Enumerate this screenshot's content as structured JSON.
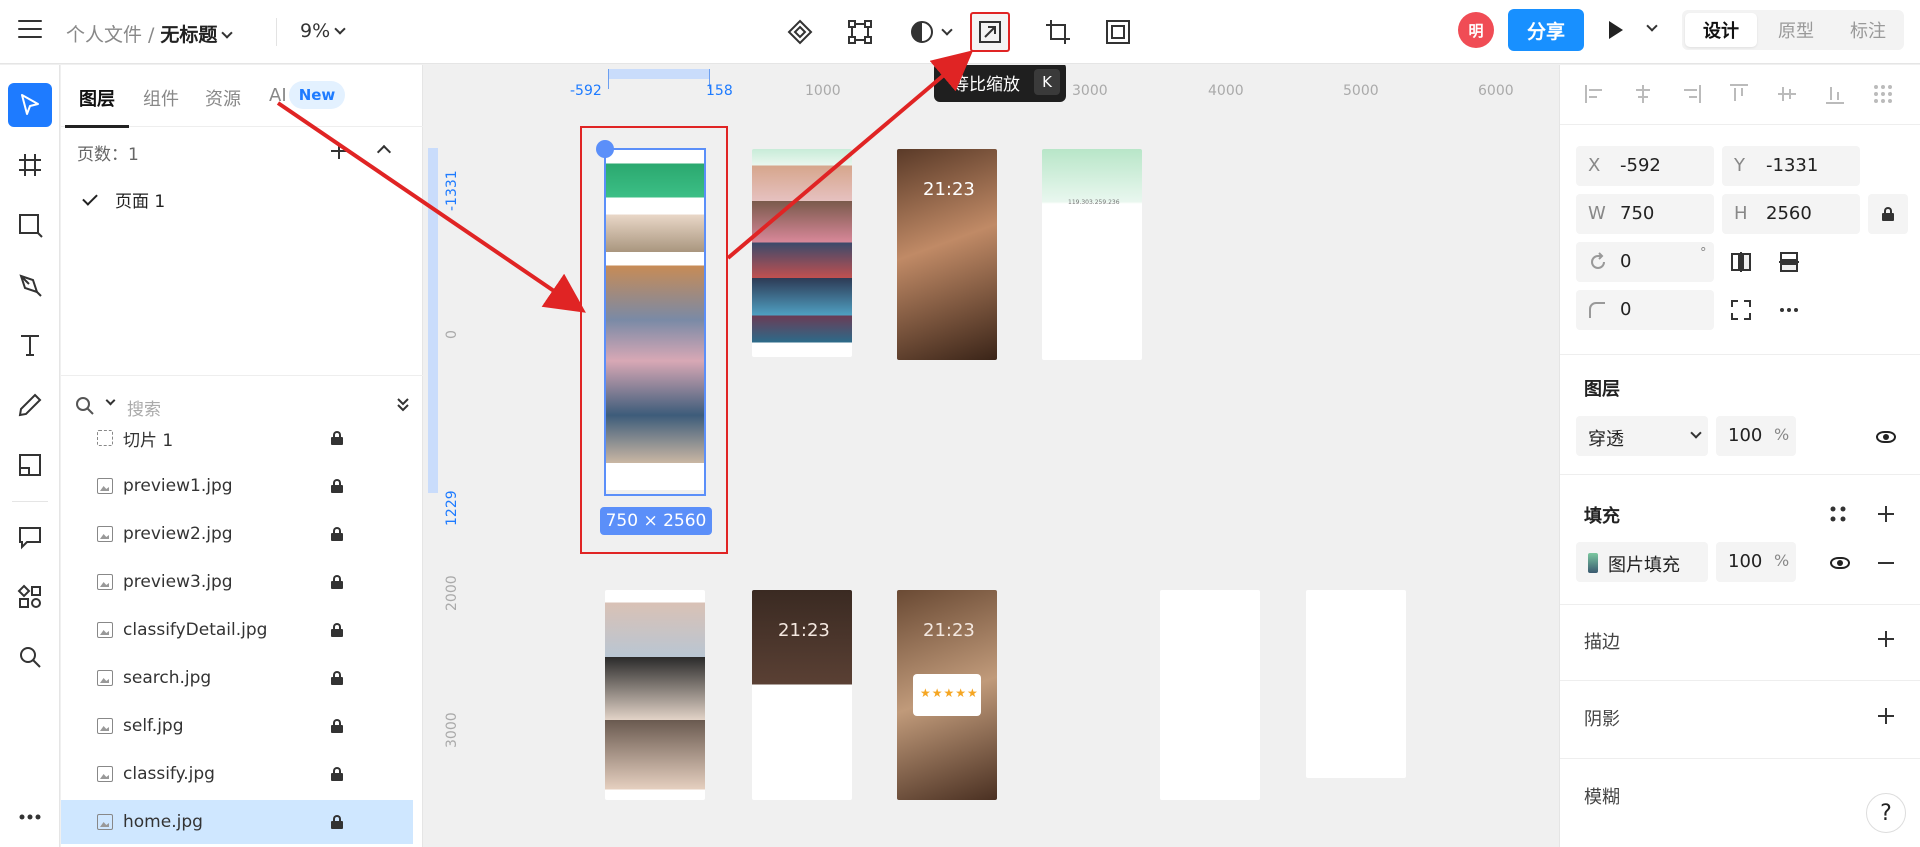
{
  "header": {
    "breadcrumb_parent": "个人文件",
    "breadcrumb_sep": "/",
    "doc_title": "无标题",
    "zoom": "9%",
    "avatar_initial": "明",
    "share_label": "分享",
    "mode_tabs": [
      "设计",
      "原型",
      "标注"
    ],
    "tooltip_label": "等比缩放",
    "tooltip_key": "K"
  },
  "left_panel": {
    "tabs": [
      "图层",
      "组件",
      "资源",
      "AI"
    ],
    "new_badge": "New",
    "pages_header": "页数：1",
    "page_item": "页面 1",
    "search_placeholder": "搜索",
    "layers": [
      {
        "name": "切片 1",
        "type": "slice"
      },
      {
        "name": "preview1.jpg",
        "type": "image"
      },
      {
        "name": "preview2.jpg",
        "type": "image"
      },
      {
        "name": "preview3.jpg",
        "type": "image"
      },
      {
        "name": "classifyDetail.jpg",
        "type": "image"
      },
      {
        "name": "search.jpg",
        "type": "image"
      },
      {
        "name": "self.jpg",
        "type": "image"
      },
      {
        "name": "classify.jpg",
        "type": "image"
      },
      {
        "name": "home.jpg",
        "type": "image",
        "selected": true
      }
    ]
  },
  "canvas": {
    "ruler_h": [
      "-592",
      "158",
      "1000",
      "3000",
      "4000",
      "5000",
      "6000"
    ],
    "ruler_v": [
      "-1331",
      "0",
      "1229",
      "2000",
      "3000"
    ],
    "selection_size": "750 × 2560",
    "thumb_text": {
      "clock1": "21:23",
      "clock2": "21:23",
      "clock3": "21:23",
      "ip": "119.303.259.236",
      "stars": "★★★★★"
    }
  },
  "properties": {
    "x_label": "X",
    "x_value": "-592",
    "y_label": "Y",
    "y_value": "-1331",
    "w_label": "W",
    "w_value": "750",
    "h_label": "H",
    "h_value": "2560",
    "rotation_value": "0",
    "rotation_unit": "°",
    "radius_value": "0",
    "layer_section": "图层",
    "blend_mode": "穿透",
    "layer_opacity": "100",
    "percent": "%",
    "fill_section": "填充",
    "fill_type": "图片填充",
    "fill_opacity": "100",
    "stroke_section": "描边",
    "shadow_section": "阴影",
    "blur_section": "模糊",
    "help": "?"
  },
  "colors": {
    "accent": "#1890ff",
    "selection": "#5b8ff9",
    "annotation_red": "#e02424",
    "selected_row": "#cfe7ff"
  }
}
